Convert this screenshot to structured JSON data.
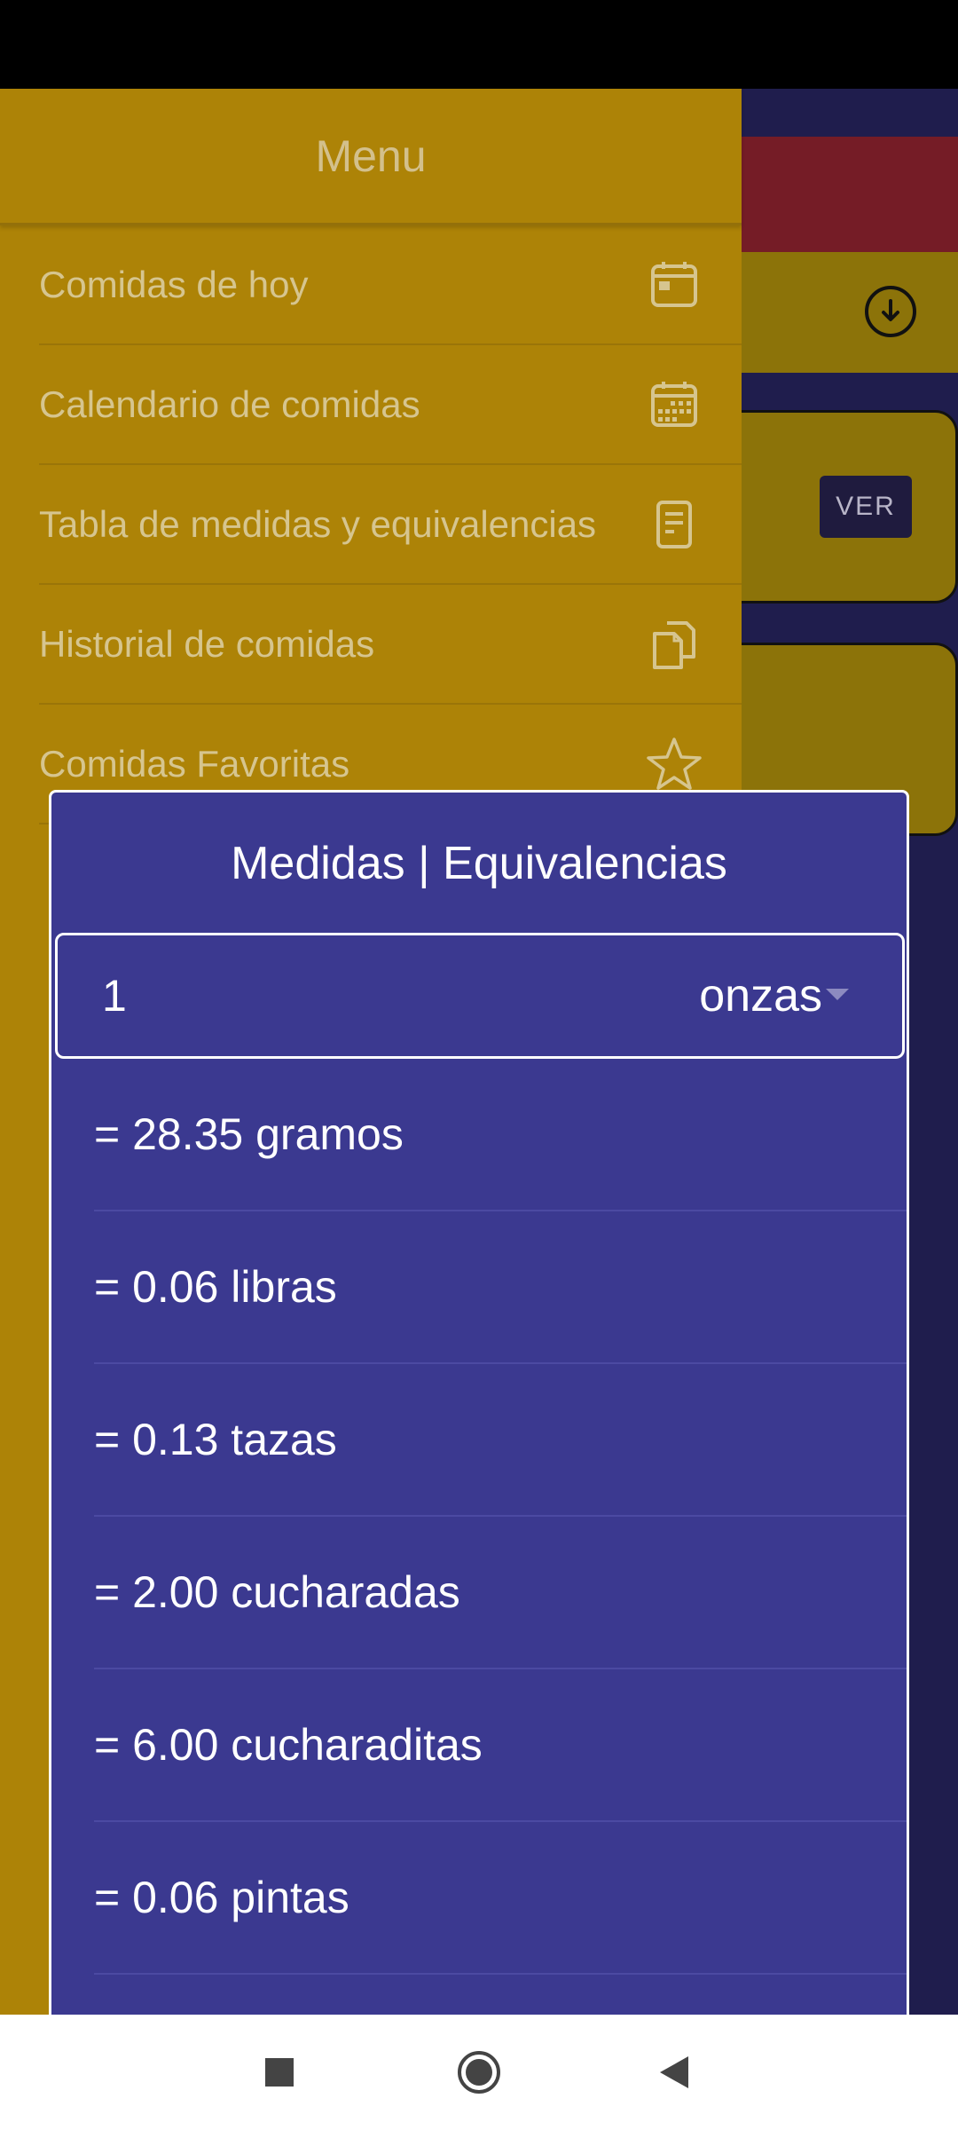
{
  "drawer": {
    "title": "Menu",
    "items": [
      {
        "label": "Comidas de hoy",
        "icon": "calendar-day-icon"
      },
      {
        "label": "Calendario de comidas",
        "icon": "calendar-month-icon"
      },
      {
        "label": "Tabla de medidas y equivalencias",
        "icon": "document-icon"
      },
      {
        "label": "Historial de comidas",
        "icon": "copy-documents-icon"
      },
      {
        "label": "Comidas Favoritas",
        "icon": "star-icon"
      }
    ]
  },
  "background": {
    "ver_label": "VER"
  },
  "dialog": {
    "title": "Medidas | Equivalencias",
    "quantity": "1",
    "unit": "onzas",
    "results": [
      "= 28.35 gramos",
      "= 0.06 libras",
      "= 0.13 tazas",
      "= 2.00 cucharadas",
      "= 6.00 cucharaditas",
      "= 0.06 pintas"
    ]
  },
  "colors": {
    "drawer_bg": "#ad8307",
    "dialog_bg": "#3b3990",
    "accent_red": "#751c26"
  }
}
